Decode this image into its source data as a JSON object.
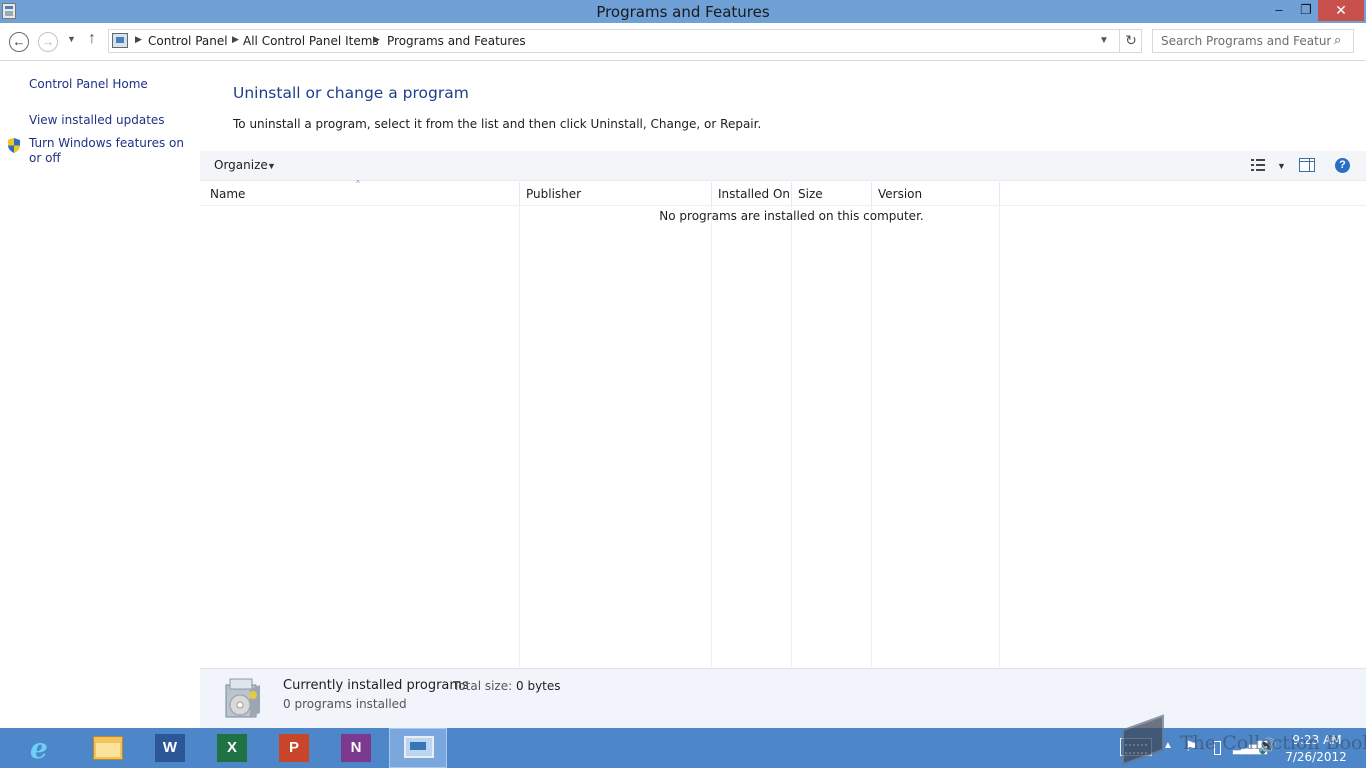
{
  "window": {
    "title": "Programs and Features",
    "minimize_label": "–",
    "maximize_label": "❐",
    "close_label": "✕"
  },
  "nav": {
    "back_glyph": "←",
    "forward_glyph": "→",
    "recent_glyph": "▼",
    "up_glyph": "↑",
    "breadcrumb": [
      "Control Panel",
      "All Control Panel Items",
      "Programs and Features"
    ],
    "separator_glyph": "▶",
    "dropdown_glyph": "▼",
    "refresh_glyph": "↻",
    "search_placeholder": "Search Programs and Features",
    "search_glyph": "⌕"
  },
  "sidebar": {
    "home_link": "Control Panel Home",
    "updates_link": "View installed updates",
    "features_link": "Turn Windows features on or off"
  },
  "main": {
    "heading": "Uninstall or change a program",
    "description": "To uninstall a program, select it from the list and then click Uninstall, Change, or Repair.",
    "empty_message": "No programs are installed on this computer."
  },
  "toolbar": {
    "organize_label": "Organize",
    "organize_glyph": "▼",
    "view_dropdown_glyph": "▼",
    "help_glyph": "?"
  },
  "table": {
    "columns": [
      "Name",
      "Publisher",
      "Installed On",
      "Size",
      "Version"
    ],
    "sort_glyph": "^",
    "rows": []
  },
  "details": {
    "title": "Currently installed programs",
    "total_size_label": "Total size:",
    "total_size_value": "0 bytes",
    "count_text": "0 programs installed"
  },
  "taskbar": {
    "ie_glyph": "e",
    "word_glyph": "W",
    "excel_glyph": "X",
    "powerpoint_glyph": "P",
    "onenote_glyph": "N",
    "tray_chevron_glyph": "▲",
    "tray_flag_glyph": "⚑",
    "tray_network_glyph": "▂▃▅▇",
    "tray_volume_glyph": "🔊",
    "clock_time": "9:23 AM",
    "clock_date": "7/26/2012"
  },
  "watermark": {
    "text": "The Collection Book"
  }
}
